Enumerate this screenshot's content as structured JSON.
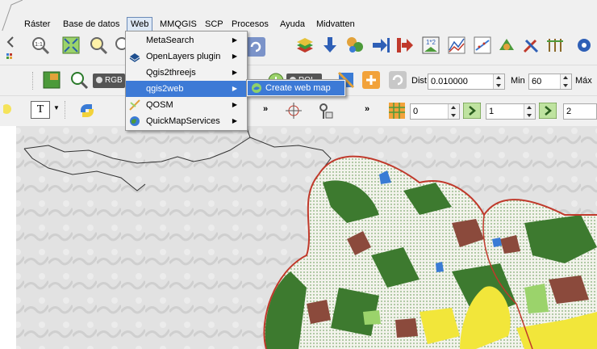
{
  "menubar": {
    "items": [
      "Ráster",
      "Base de datos",
      "Web",
      "MMQGIS",
      "SCP",
      "Procesos",
      "Ayuda",
      "Midvatten"
    ],
    "active": "Web"
  },
  "web_menu": {
    "items": [
      {
        "label": "MetaSearch",
        "icon": "none",
        "has_submenu": true
      },
      {
        "label": "OpenLayers plugin",
        "icon": "openlayers-icon",
        "has_submenu": true
      },
      {
        "label": "Qgis2threejs",
        "icon": "none",
        "has_submenu": true
      },
      {
        "label": "qgis2web",
        "icon": "none",
        "has_submenu": true,
        "highlighted": true
      },
      {
        "label": "QOSM",
        "icon": "qosm-icon",
        "has_submenu": true
      },
      {
        "label": "QuickMapServices",
        "icon": "globe-icon",
        "has_submenu": true
      }
    ]
  },
  "qgis2web_submenu": {
    "label": "Create web map",
    "icon": "qgis2web-icon"
  },
  "toolbar2": {
    "rgb_label": "RGB",
    "roi_label": "ROI",
    "dist_label": "Dist",
    "dist_value": "0.010000",
    "min_label": "Min",
    "min_value": "60",
    "max_label": "Máx"
  },
  "toolbar3": {
    "spin1_value": "0",
    "spin2_value": "1",
    "spin3_value": "2",
    "more_glyph": "»"
  },
  "colors": {
    "highlight": "#3d7ad6",
    "forest": "#3d7a2f",
    "boundary": "#c0392b",
    "yellow": "#f2e63a",
    "brown": "#8b4a3c"
  }
}
